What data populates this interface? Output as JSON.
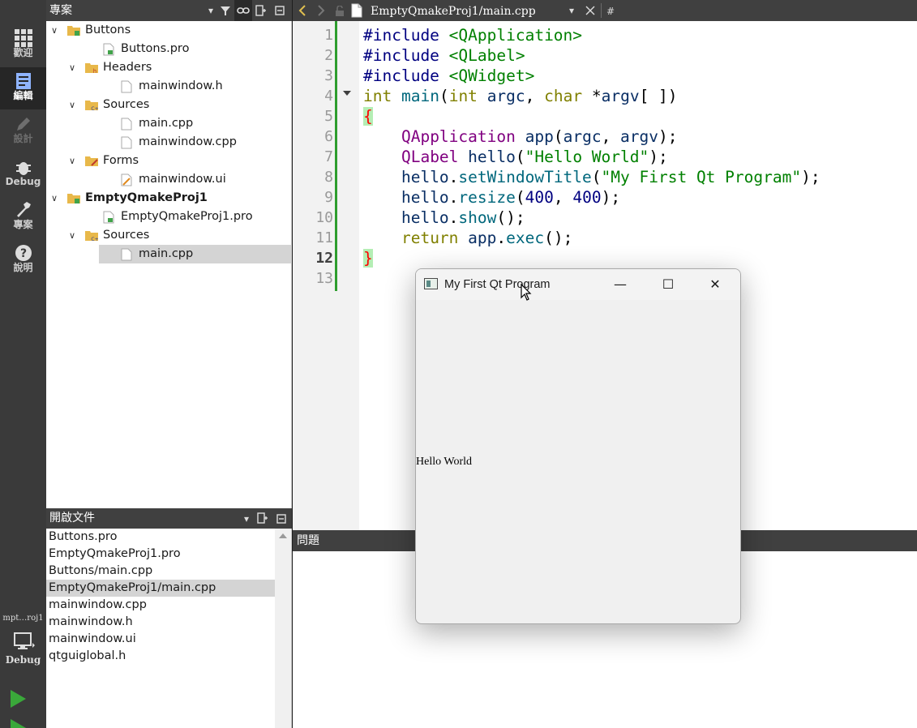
{
  "modes": [
    {
      "label": "歡迎",
      "icon": "grid-icon"
    },
    {
      "label": "編輯",
      "icon": "edit-icon"
    },
    {
      "label": "設計",
      "icon": "pencil-icon"
    },
    {
      "label": "Debug",
      "icon": "bug-icon"
    },
    {
      "label": "專案",
      "icon": "wrench-icon"
    },
    {
      "label": "說明",
      "icon": "help-icon"
    }
  ],
  "kit": {
    "label": "mpt…roj1",
    "mode": "Debug"
  },
  "project_panel": {
    "title": "專案"
  },
  "tree": [
    {
      "label": "Buttons",
      "depth": 1,
      "arrow": "∨",
      "icon": "qt-folder-icon",
      "bold": false
    },
    {
      "label": "Buttons.pro",
      "depth": 2,
      "arrow": "",
      "icon": "pro-file-icon",
      "bold": false
    },
    {
      "label": "Headers",
      "depth": 2,
      "arrow": "∨",
      "icon": "h-folder-icon",
      "bold": false
    },
    {
      "label": "mainwindow.h",
      "depth": 3,
      "arrow": "",
      "icon": "file-icon",
      "bold": false
    },
    {
      "label": "Sources",
      "depth": 2,
      "arrow": "∨",
      "icon": "cpp-folder-icon",
      "bold": false
    },
    {
      "label": "main.cpp",
      "depth": 3,
      "arrow": "",
      "icon": "file-icon",
      "bold": false
    },
    {
      "label": "mainwindow.cpp",
      "depth": 3,
      "arrow": "",
      "icon": "file-icon",
      "bold": false
    },
    {
      "label": "Forms",
      "depth": 2,
      "arrow": "∨",
      "icon": "forms-folder-icon",
      "bold": false
    },
    {
      "label": "mainwindow.ui",
      "depth": 3,
      "arrow": "",
      "icon": "ui-file-icon",
      "bold": false
    },
    {
      "label": "EmptyQmakeProj1",
      "depth": 1,
      "arrow": "∨",
      "icon": "qt-folder-icon",
      "bold": true
    },
    {
      "label": "EmptyQmakeProj1.pro",
      "depth": 2,
      "arrow": "",
      "icon": "pro-file-icon",
      "bold": false
    },
    {
      "label": "Sources",
      "depth": 2,
      "arrow": "∨",
      "icon": "cpp-folder-icon",
      "bold": false
    },
    {
      "label": "main.cpp",
      "depth": 3,
      "arrow": "",
      "icon": "file-icon",
      "bold": false,
      "selected": true
    }
  ],
  "open_docs_panel": {
    "title": "開啟文件"
  },
  "open_docs": [
    {
      "label": "Buttons.pro"
    },
    {
      "label": "EmptyQmakeProj1.pro"
    },
    {
      "label": "Buttons/main.cpp"
    },
    {
      "label": "EmptyQmakeProj1/main.cpp",
      "selected": true
    },
    {
      "label": "mainwindow.cpp"
    },
    {
      "label": "mainwindow.h"
    },
    {
      "label": "mainwindow.ui"
    },
    {
      "label": "qtguiglobal.h"
    }
  ],
  "editor": {
    "file_path": "EmptyQmakeProj1/main.cpp",
    "symbol_label": "#",
    "current_line": 12,
    "line_numbers": [
      "1",
      "2",
      "3",
      "4",
      "5",
      "6",
      "7",
      "8",
      "9",
      "10",
      "11",
      "12",
      "13"
    ],
    "lines": [
      [
        {
          "t": "#include ",
          "c": "pp"
        },
        {
          "t": "<QApplication>",
          "c": "inc"
        }
      ],
      [
        {
          "t": "#include ",
          "c": "pp"
        },
        {
          "t": "<QLabel>",
          "c": "inc"
        }
      ],
      [
        {
          "t": "#include ",
          "c": "pp"
        },
        {
          "t": "<QWidget>",
          "c": "inc"
        }
      ],
      [
        {
          "t": "int",
          "c": "kw"
        },
        {
          "t": " ",
          "c": ""
        },
        {
          "t": "main",
          "c": "fn"
        },
        {
          "t": "(",
          "c": ""
        },
        {
          "t": "int",
          "c": "kw"
        },
        {
          "t": " ",
          "c": ""
        },
        {
          "t": "argc",
          "c": "var"
        },
        {
          "t": ", ",
          "c": ""
        },
        {
          "t": "char",
          "c": "kw"
        },
        {
          "t": " *",
          "c": ""
        },
        {
          "t": "argv",
          "c": "var"
        },
        {
          "t": "[ ])",
          "c": ""
        }
      ],
      [
        {
          "t": "{",
          "c": "brace"
        }
      ],
      [
        {
          "t": "    ",
          "c": ""
        },
        {
          "t": "QApplication",
          "c": "ty"
        },
        {
          "t": " ",
          "c": ""
        },
        {
          "t": "app",
          "c": "var"
        },
        {
          "t": "(",
          "c": ""
        },
        {
          "t": "argc",
          "c": "var"
        },
        {
          "t": ", ",
          "c": ""
        },
        {
          "t": "argv",
          "c": "var"
        },
        {
          "t": ");",
          "c": ""
        }
      ],
      [
        {
          "t": "    ",
          "c": ""
        },
        {
          "t": "QLabel",
          "c": "ty"
        },
        {
          "t": " ",
          "c": ""
        },
        {
          "t": "hello",
          "c": "var"
        },
        {
          "t": "(",
          "c": ""
        },
        {
          "t": "\"Hello World\"",
          "c": "str"
        },
        {
          "t": ");",
          "c": ""
        }
      ],
      [
        {
          "t": "    ",
          "c": ""
        },
        {
          "t": "hello",
          "c": "var"
        },
        {
          "t": ".",
          "c": ""
        },
        {
          "t": "setWindowTitle",
          "c": "fn"
        },
        {
          "t": "(",
          "c": ""
        },
        {
          "t": "\"My First Qt Program\"",
          "c": "str"
        },
        {
          "t": ");",
          "c": ""
        }
      ],
      [
        {
          "t": "    ",
          "c": ""
        },
        {
          "t": "hello",
          "c": "var"
        },
        {
          "t": ".",
          "c": ""
        },
        {
          "t": "resize",
          "c": "fn"
        },
        {
          "t": "(",
          "c": ""
        },
        {
          "t": "400",
          "c": "num"
        },
        {
          "t": ", ",
          "c": ""
        },
        {
          "t": "400",
          "c": "num"
        },
        {
          "t": ");",
          "c": ""
        }
      ],
      [
        {
          "t": "    ",
          "c": ""
        },
        {
          "t": "hello",
          "c": "var"
        },
        {
          "t": ".",
          "c": ""
        },
        {
          "t": "show",
          "c": "fn"
        },
        {
          "t": "();",
          "c": ""
        }
      ],
      [
        {
          "t": "    ",
          "c": ""
        },
        {
          "t": "return",
          "c": "kw"
        },
        {
          "t": " ",
          "c": ""
        },
        {
          "t": "app",
          "c": "var"
        },
        {
          "t": ".",
          "c": ""
        },
        {
          "t": "exec",
          "c": "fn"
        },
        {
          "t": "();",
          "c": ""
        }
      ],
      [
        {
          "t": "}",
          "c": "brace"
        }
      ],
      []
    ]
  },
  "issues_panel": {
    "title": "問題"
  },
  "app_window": {
    "title": "My First Qt Program",
    "label_text": "Hello World",
    "minimize_glyph": "—",
    "maximize_glyph": "☐",
    "close_glyph": "✕"
  },
  "colors": {
    "modebar": "#3a3a3a",
    "panel_header": "#404040",
    "selection": "#d4d4d4",
    "gutter_marker": "#2e9d2e",
    "run_green": "#3aa83a"
  }
}
